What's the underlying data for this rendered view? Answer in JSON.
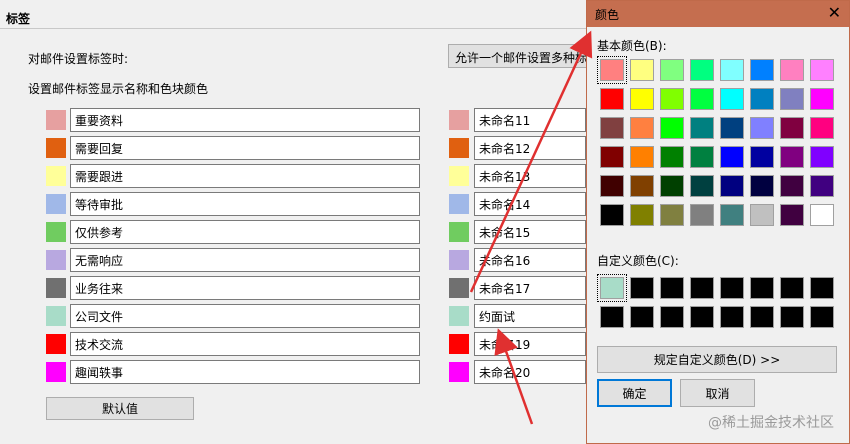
{
  "main": {
    "section_title": "标签",
    "tag_setting_label": "对邮件设置标签时:",
    "tag_select_value": "允许一个邮件设置多种标签",
    "display_label": "设置邮件标签显示名称和色块颜色",
    "default_button": "默认值",
    "left_tags": [
      {
        "name": "重要资料",
        "color": "#e6a0a0"
      },
      {
        "name": "需要回复",
        "color": "#e06010"
      },
      {
        "name": "需要跟进",
        "color": "#ffff99"
      },
      {
        "name": "等待审批",
        "color": "#a0b8e8"
      },
      {
        "name": "仅供参考",
        "color": "#70cc60"
      },
      {
        "name": "无需响应",
        "color": "#b8a8e0"
      },
      {
        "name": "业务往来",
        "color": "#707070"
      },
      {
        "name": "公司文件",
        "color": "#a8dcc8"
      },
      {
        "name": "技术交流",
        "color": "#ff0000"
      },
      {
        "name": "趣闻轶事",
        "color": "#ff00ff"
      }
    ],
    "right_tags": [
      {
        "name": "未命名11",
        "color": "#e6a0a0"
      },
      {
        "name": "未命名12",
        "color": "#e06010"
      },
      {
        "name": "未命名13",
        "color": "#ffff99"
      },
      {
        "name": "未命名14",
        "color": "#a0b8e8"
      },
      {
        "name": "未命名15",
        "color": "#70cc60"
      },
      {
        "name": "未命名16",
        "color": "#b8a8e0"
      },
      {
        "name": "未命名17",
        "color": "#707070"
      },
      {
        "name": "约面试",
        "color": "#a8dcc8"
      },
      {
        "name": "未命名19",
        "color": "#ff0000"
      },
      {
        "name": "未命名20",
        "color": "#ff00ff"
      }
    ]
  },
  "dialog": {
    "title": "颜色",
    "close_glyph": "✕",
    "basic_label": "基本颜色(B):",
    "custom_label": "自定义颜色(C):",
    "define_button": "规定自定义颜色(D) >>",
    "ok_button": "确定",
    "cancel_button": "取消",
    "basic_colors": [
      "#ff8080",
      "#ffff80",
      "#80ff80",
      "#00ff80",
      "#80ffff",
      "#0080ff",
      "#ff80c0",
      "#ff80ff",
      "#ff0000",
      "#ffff00",
      "#80ff00",
      "#00ff40",
      "#00ffff",
      "#0080c0",
      "#8080c0",
      "#ff00ff",
      "#804040",
      "#ff8040",
      "#00ff00",
      "#008080",
      "#004080",
      "#8080ff",
      "#800040",
      "#ff0080",
      "#800000",
      "#ff8000",
      "#008000",
      "#008040",
      "#0000ff",
      "#0000a0",
      "#800080",
      "#8000ff",
      "#400000",
      "#804000",
      "#004000",
      "#004040",
      "#000080",
      "#000040",
      "#400040",
      "#400080",
      "#000000",
      "#808000",
      "#808040",
      "#808080",
      "#408080",
      "#c0c0c0",
      "#400040",
      "#ffffff"
    ],
    "custom_colors": [
      "#a8dcc8",
      "#000000",
      "#000000",
      "#000000",
      "#000000",
      "#000000",
      "#000000",
      "#000000",
      "#000000",
      "#000000",
      "#000000",
      "#000000",
      "#000000",
      "#000000",
      "#000000",
      "#000000"
    ]
  },
  "watermark": "@稀土掘金技术社区"
}
